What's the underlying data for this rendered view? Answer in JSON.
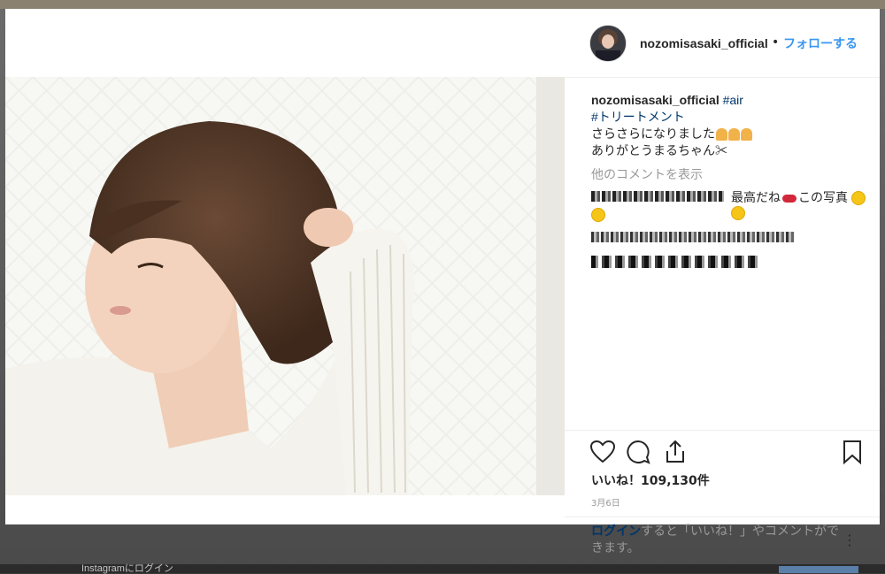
{
  "post": {
    "username": "nozomisasaki_official",
    "dot": "•",
    "follow_label": "フォローする"
  },
  "caption": {
    "username": "nozomisasaki_official",
    "hashtag1": "#air",
    "hashtag2": "#トリートメント",
    "line1": "さらさらになりました",
    "line2": "ありがとうまるちゃん✂"
  },
  "comments": {
    "more_label": "他のコメントを表示",
    "comment1_text_a": "最高だね",
    "comment1_text_b": "この写真"
  },
  "stats": {
    "likes": "いいね！109,130件",
    "date": "3月6日"
  },
  "login_prompt": {
    "link": "ログイン",
    "text": "すると「いいね！」やコメントができます。",
    "more": "⋮"
  },
  "backdrop": {
    "login_text": "Instagramにログイン"
  },
  "icons": [
    "heart-icon",
    "comment-icon",
    "share-icon",
    "bookmark-icon",
    "more-options-icon"
  ],
  "colors": {
    "accent": "#3897f0",
    "hashtag": "#003569",
    "text": "#262626",
    "muted": "#999999"
  }
}
